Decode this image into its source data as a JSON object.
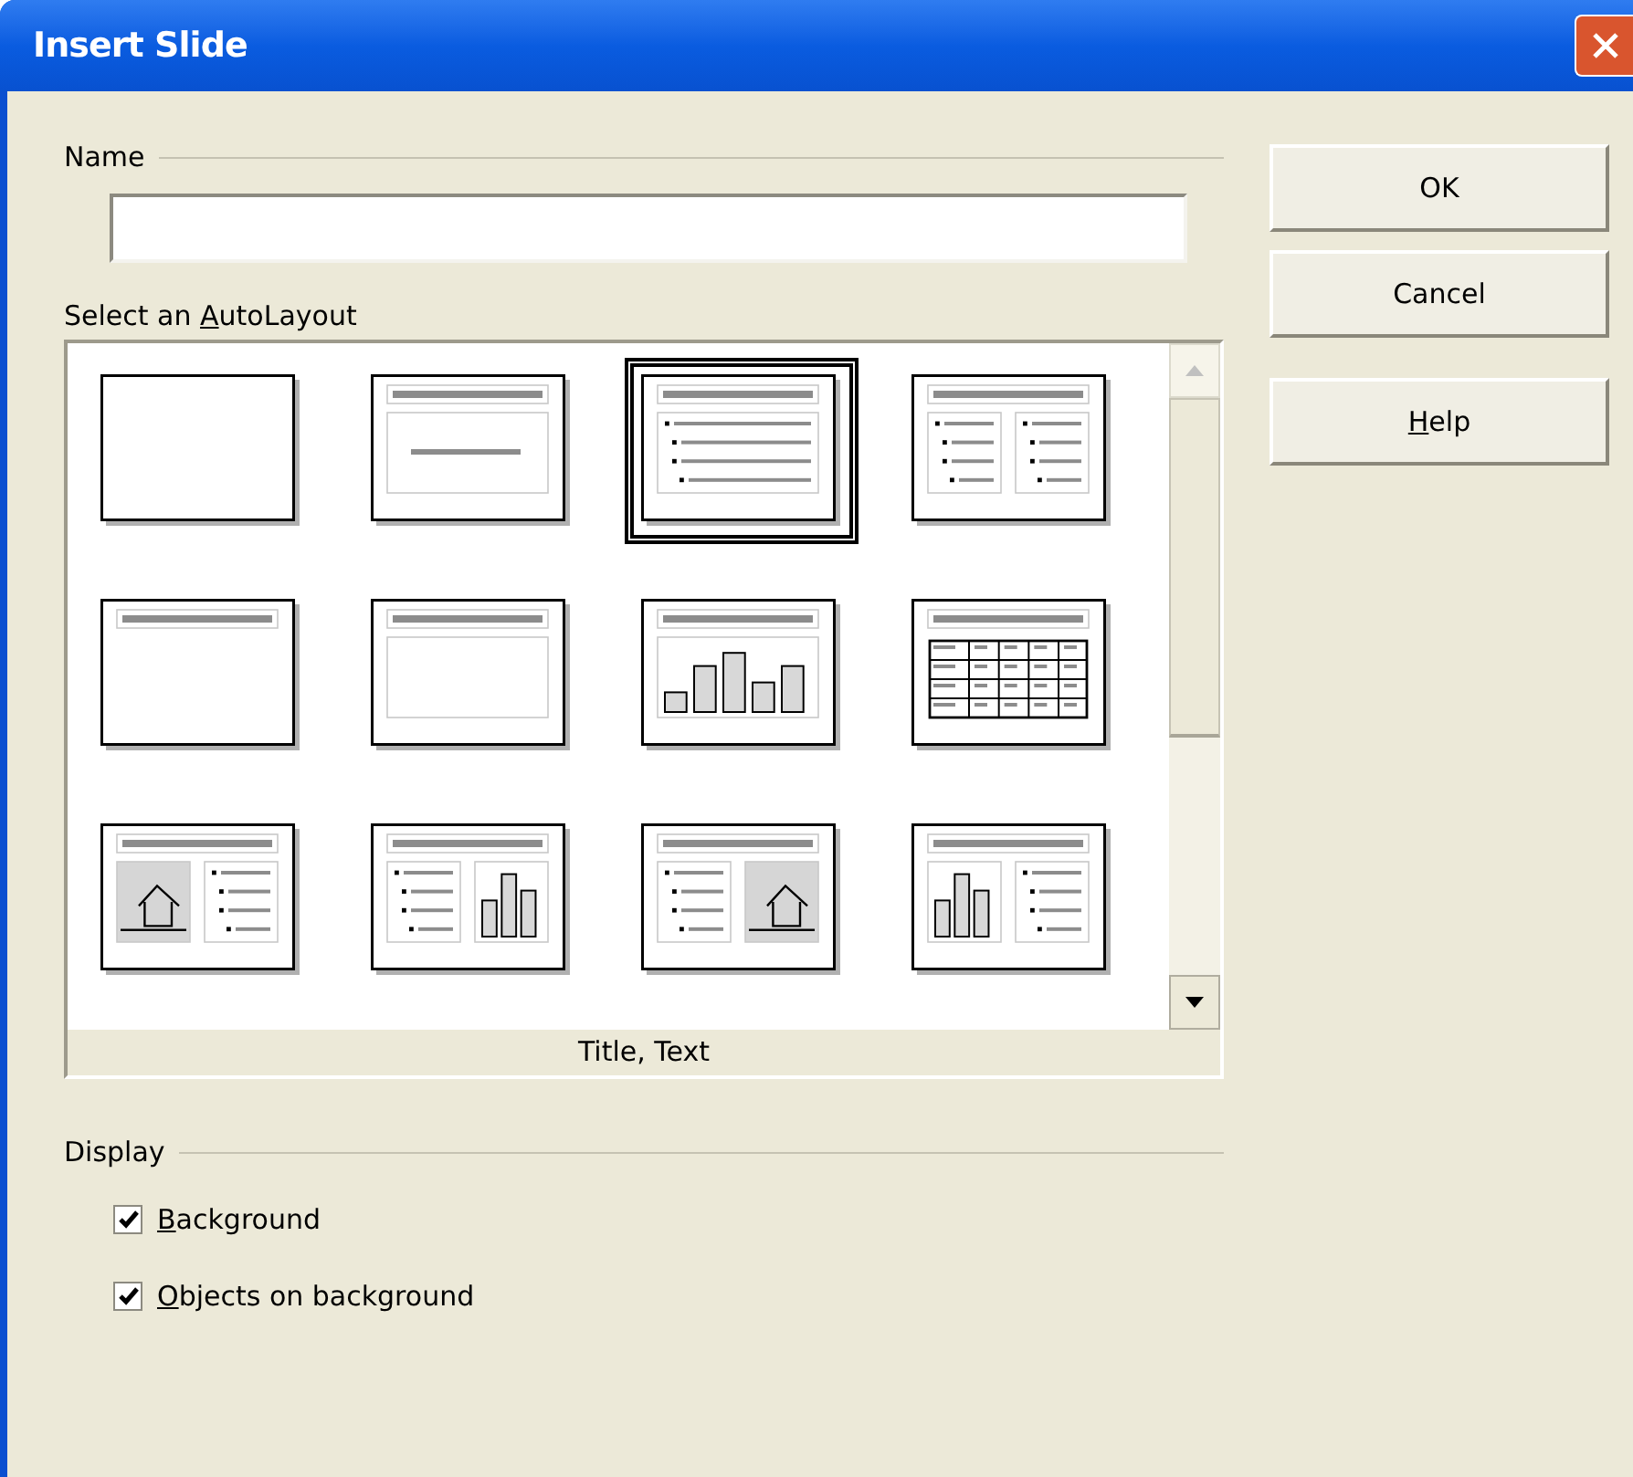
{
  "window": {
    "title": "Insert Slide"
  },
  "name_section": {
    "heading": "Name"
  },
  "layout_section": {
    "label": {
      "before": "Select an ",
      "underlined": "A",
      "after": "utoLayout"
    },
    "caption": "Title, Text",
    "layouts": [
      {
        "kind": "blank",
        "selected": false
      },
      {
        "kind": "title-subtitle",
        "selected": false
      },
      {
        "kind": "title-text",
        "selected": true
      },
      {
        "kind": "title-two-text",
        "selected": false
      },
      {
        "kind": "title-only",
        "selected": false
      },
      {
        "kind": "title-content",
        "selected": false
      },
      {
        "kind": "title-chart",
        "selected": false
      },
      {
        "kind": "title-table",
        "selected": false
      },
      {
        "kind": "title-image-text",
        "selected": false
      },
      {
        "kind": "title-text-chart",
        "selected": false
      },
      {
        "kind": "title-text-image",
        "selected": false
      },
      {
        "kind": "title-chart-text",
        "selected": false
      }
    ]
  },
  "buttons": [
    {
      "after": "OK"
    },
    {
      "after": "Cancel"
    },
    {
      "underlined": "H",
      "after": "elp"
    }
  ],
  "display": {
    "heading": "Display",
    "options": [
      {
        "underlined": "B",
        "after": "ackground",
        "checked": true
      },
      {
        "underlined": "O",
        "after": "bjects on background",
        "checked": true
      }
    ]
  }
}
